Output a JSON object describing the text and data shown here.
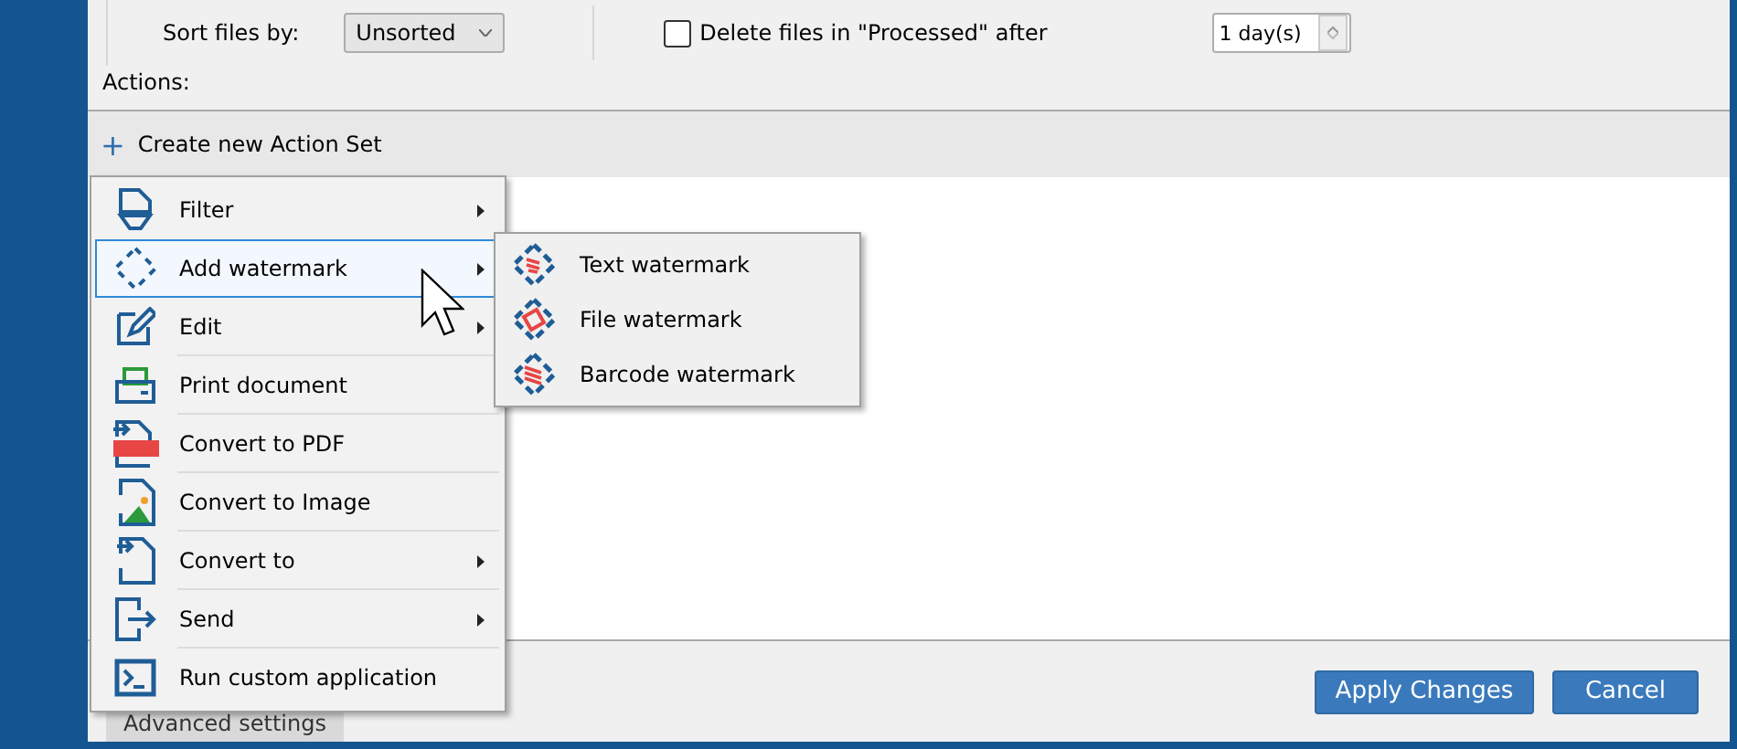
{
  "options": {
    "sort_label": "Sort files by:",
    "sort_value": "Unsorted",
    "delete_checkbox": {
      "label": "Delete files in \"Processed\" after",
      "checked": false
    },
    "delete_after": "1 day(s)"
  },
  "actions_label": "Actions:",
  "create_action_set": {
    "icon": "+",
    "label": "Create new Action Set"
  },
  "context_menu": [
    {
      "label": "Filter",
      "has_submenu": true,
      "selected": false
    },
    {
      "label": "Add watermark",
      "has_submenu": true,
      "selected": true
    },
    {
      "label": "Edit",
      "has_submenu": true,
      "selected": false
    },
    {
      "label": "Print document",
      "has_submenu": false,
      "selected": false
    },
    {
      "label": "Convert to PDF",
      "has_submenu": false,
      "selected": false
    },
    {
      "label": "Convert to Image",
      "has_submenu": false,
      "selected": false
    },
    {
      "label": "Convert to",
      "has_submenu": true,
      "selected": false
    },
    {
      "label": "Send",
      "has_submenu": true,
      "selected": false
    },
    {
      "label": "Run custom application",
      "has_submenu": false,
      "selected": false
    }
  ],
  "submenu": [
    {
      "label": "Text watermark"
    },
    {
      "label": "File watermark"
    },
    {
      "label": "Barcode watermark"
    }
  ],
  "footer": {
    "advanced_button": "Advanced settings",
    "buttons": [
      "Apply Changes",
      "Cancel"
    ]
  }
}
